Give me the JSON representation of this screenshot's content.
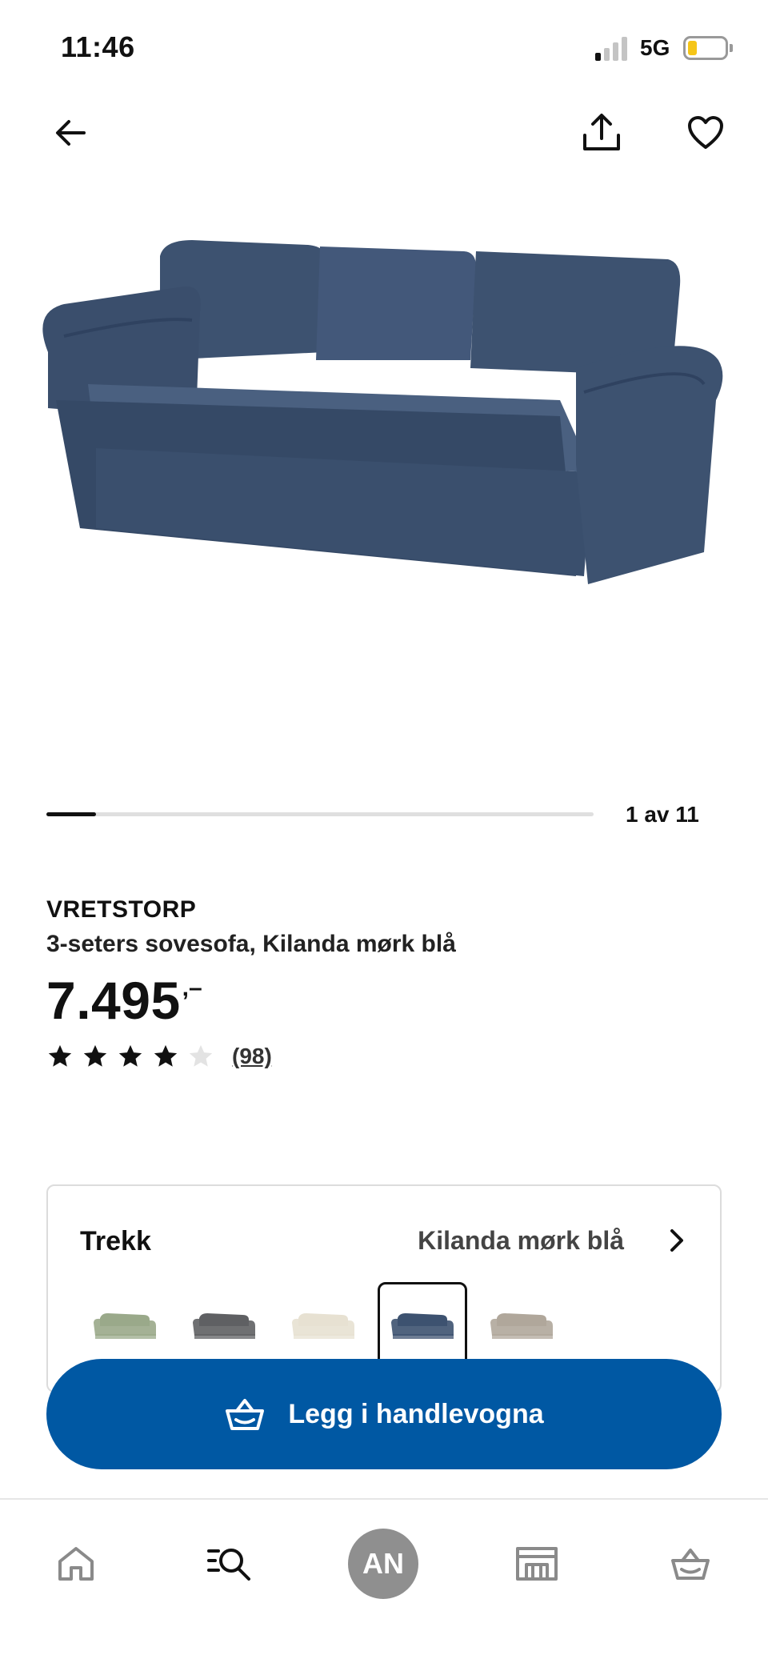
{
  "status_bar": {
    "time": "11:46",
    "network": "5G",
    "signal_bars_filled": 1,
    "signal_bars_total": 4,
    "battery_level": 0.25,
    "battery_color": "#f5c518"
  },
  "top_nav": {
    "back_icon": "arrow-left-icon",
    "share_icon": "share-icon",
    "favorite_icon": "heart-icon"
  },
  "product_image": {
    "subject": "sofa",
    "color": "#3d5270"
  },
  "carousel": {
    "counter": "1 av 11",
    "position": 1,
    "total": 11
  },
  "product": {
    "brand": "VRETSTORP",
    "description": "3-seters sovesofa, Kilanda mørk blå",
    "price": "7.495",
    "price_suffix": ",–",
    "rating_value": 4,
    "rating_max": 5,
    "review_count": "(98)"
  },
  "variant": {
    "label": "Trekk",
    "selected_value": "Kilanda mørk blå",
    "swatches": [
      {
        "color": "#9aa98a",
        "selected": false
      },
      {
        "color": "#5f6063",
        "selected": false
      },
      {
        "color": "#e7e1d2",
        "selected": false
      },
      {
        "color": "#3d5270",
        "selected": true
      },
      {
        "color": "#b0a79b",
        "selected": false
      }
    ]
  },
  "cta": {
    "label": "Legg i handlevogna",
    "icon": "basket-icon",
    "color": "#0058a3"
  },
  "tab_bar": {
    "items": [
      {
        "name": "home",
        "icon": "home-icon"
      },
      {
        "name": "search",
        "icon": "search-list-icon"
      },
      {
        "name": "profile",
        "initials": "AN"
      },
      {
        "name": "stores",
        "icon": "store-icon"
      },
      {
        "name": "basket",
        "icon": "basket-icon"
      }
    ]
  }
}
